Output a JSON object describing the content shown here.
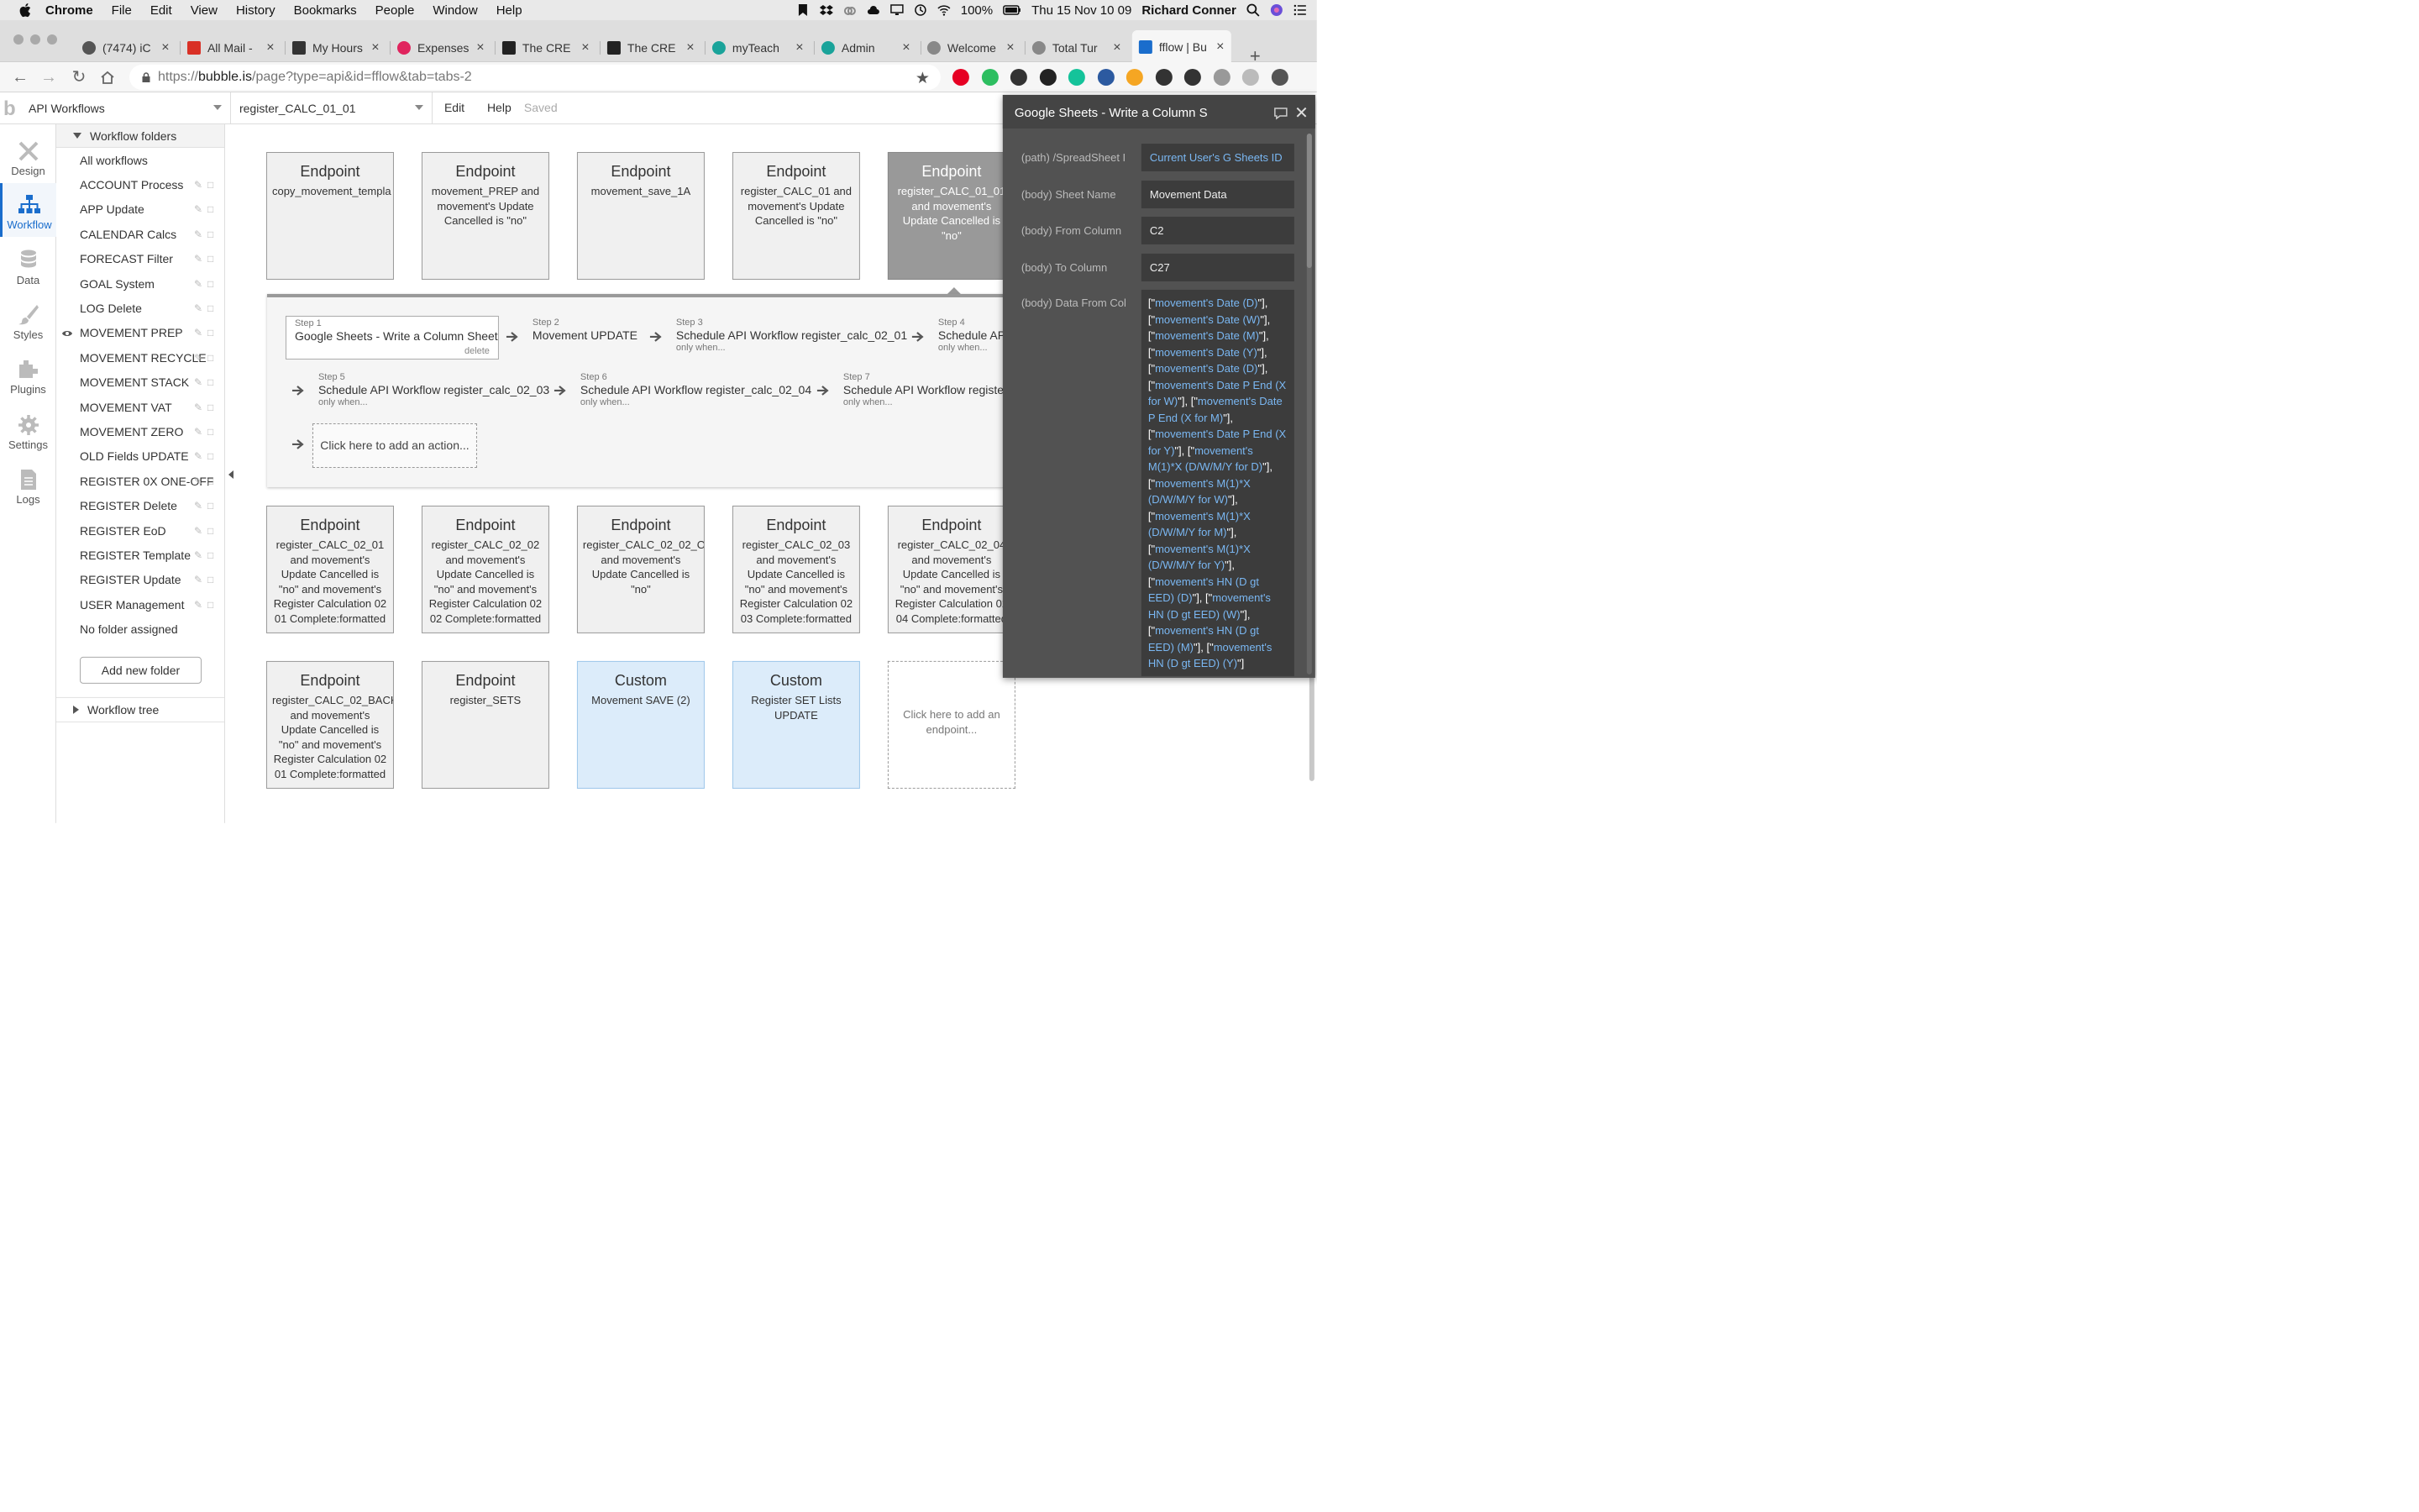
{
  "macbar": {
    "app_name": "Chrome",
    "menus": [
      "File",
      "Edit",
      "View",
      "History",
      "Bookmarks",
      "People",
      "Window",
      "Help"
    ],
    "battery": "100%",
    "clock": "Thu 15 Nov  10 09",
    "user": "Richard Conner"
  },
  "tabs": [
    {
      "title": "(7474) iC",
      "icon": "record-icon",
      "color": "#555555"
    },
    {
      "title": "All Mail -",
      "icon": "gmail-icon",
      "color": "#d93025"
    },
    {
      "title": "My Hours",
      "icon": "stopwatch-icon",
      "color": "#333333"
    },
    {
      "title": "Expenses",
      "icon": "target-icon",
      "color": "#e0245e"
    },
    {
      "title": "The CRE",
      "icon": "bracket-icon",
      "color": "#222222"
    },
    {
      "title": "The CRE",
      "icon": "bracket-icon",
      "color": "#222222"
    },
    {
      "title": "myTeach",
      "icon": "t-icon",
      "color": "#1aa39a"
    },
    {
      "title": "Admin",
      "icon": "t-icon",
      "color": "#1aa39a"
    },
    {
      "title": "Welcome",
      "icon": "spiral-icon",
      "color": "#888888"
    },
    {
      "title": "Total Tur",
      "icon": "spiral-icon",
      "color": "#888888"
    },
    {
      "title": "fflow | Bu",
      "icon": "bubble-icon",
      "color": "#1a6dcc"
    }
  ],
  "address": {
    "url_scheme": "https://",
    "url_host": "bubble.is",
    "url_path": "/page?type=api&id=fflow&tab=tabs-2"
  },
  "extensions": [
    {
      "name": "pinterest-icon",
      "color": "#e60023"
    },
    {
      "name": "evernote-icon",
      "color": "#2dbe60"
    },
    {
      "name": "chart-icon",
      "color": "#333333"
    },
    {
      "name": "owl-icon",
      "color": "#222222"
    },
    {
      "name": "grammarly-icon",
      "color": "#15c39a"
    },
    {
      "name": "grid-icon",
      "color": "#2c5aa0"
    },
    {
      "name": "compass-icon",
      "color": "#f5a623"
    },
    {
      "name": "inbox-icon",
      "color": "#333333"
    },
    {
      "name": "globe-icon",
      "color": "#333333"
    },
    {
      "name": "cloud-icon",
      "color": "#999999"
    },
    {
      "name": "profile-icon",
      "color": "#bbbbbb"
    },
    {
      "name": "menu-icon",
      "color": "#555555"
    }
  ],
  "bubble": {
    "page_select": "API Workflows",
    "workflow_select": "register_CALC_01_01",
    "menu_edit": "Edit",
    "menu_help": "Help",
    "status": "Saved"
  },
  "sidebar": [
    {
      "label": "Design",
      "icon": "design-icon"
    },
    {
      "label": "Workflow",
      "icon": "workflow-icon",
      "active": true
    },
    {
      "label": "Data",
      "icon": "database-icon"
    },
    {
      "label": "Styles",
      "icon": "brush-icon"
    },
    {
      "label": "Plugins",
      "icon": "plugins-icon"
    },
    {
      "label": "Settings",
      "icon": "gear-icon"
    },
    {
      "label": "Logs",
      "icon": "document-icon"
    }
  ],
  "folders": {
    "header": "Workflow folders",
    "all": "All workflows",
    "items": [
      "ACCOUNT Process",
      "APP Update",
      "CALENDAR Calcs",
      "FORECAST Filter",
      "GOAL System",
      "LOG Delete",
      "MOVEMENT PREP",
      "MOVEMENT RECYCLE",
      "MOVEMENT STACK",
      "MOVEMENT VAT",
      "MOVEMENT ZERO",
      "OLD Fields UPDATE",
      "REGISTER 0X ONE-OFF",
      "REGISTER Delete",
      "REGISTER EoD",
      "REGISTER Template",
      "REGISTER Update",
      "USER Management"
    ],
    "no_folder": "No folder assigned",
    "add_button": "Add new folder",
    "tree": "Workflow tree"
  },
  "endpoints_row1": [
    {
      "type": "Endpoint",
      "desc": "copy_movement_templa"
    },
    {
      "type": "Endpoint",
      "desc": "movement_PREP and movement's Update Cancelled is \"no\""
    },
    {
      "type": "Endpoint",
      "desc": "movement_save_1A"
    },
    {
      "type": "Endpoint",
      "desc": "register_CALC_01 and movement's Update Cancelled is \"no\""
    },
    {
      "type": "Endpoint",
      "desc": "register_CALC_01_01 and movement's Update Cancelled is \"no\"",
      "selected": true
    }
  ],
  "steps": [
    {
      "num": "Step 1",
      "name": "Google Sheets - Write a Column Sheet",
      "extra": "delete"
    },
    {
      "num": "Step 2",
      "name": "Movement UPDATE",
      "extra": ""
    },
    {
      "num": "Step 3",
      "name": "Schedule API Workflow register_calc_02_01",
      "extra": "only when..."
    },
    {
      "num": "Step 4",
      "name": "Schedule API",
      "extra": "only when..."
    },
    {
      "num": "Step 5",
      "name": "Schedule API Workflow register_calc_02_03",
      "extra": "only when..."
    },
    {
      "num": "Step 6",
      "name": "Schedule API Workflow register_calc_02_04",
      "extra": "only when..."
    },
    {
      "num": "Step 7",
      "name": "Schedule API Workflow register",
      "extra": "only when..."
    }
  ],
  "add_action": "Click here to add an action...",
  "endpoints_row2": [
    {
      "type": "Endpoint",
      "desc": "register_CALC_02_01 and movement's Update Cancelled is \"no\" and movement's Register Calculation 02 01 Complete:formatted"
    },
    {
      "type": "Endpoint",
      "desc": "register_CALC_02_02 and movement's Update Cancelled is \"no\" and movement's Register Calculation 02 02 Complete:formatted"
    },
    {
      "type": "Endpoint",
      "desc": "register_CALC_02_02_OL and movement's Update Cancelled is \"no\""
    },
    {
      "type": "Endpoint",
      "desc": "register_CALC_02_03 and movement's Update Cancelled is \"no\" and movement's Register Calculation 02 03 Complete:formatted"
    },
    {
      "type": "Endpoint",
      "desc": "register_CALC_02_04 and movement's Update Cancelled is \"no\" and movement's Register Calculation 02 04 Complete:formatted"
    }
  ],
  "endpoints_row3": [
    {
      "type": "Endpoint",
      "desc": "register_CALC_02_BACK and movement's Update Cancelled is \"no\" and movement's Register Calculation 02 01 Complete:formatted"
    },
    {
      "type": "Endpoint",
      "desc": "register_SETS"
    },
    {
      "type": "Custom",
      "desc": "Movement SAVE (2)",
      "custom": true
    },
    {
      "type": "Custom",
      "desc": "Register SET Lists UPDATE",
      "custom": true
    },
    {
      "type": "",
      "desc": "Click here to add an endpoint...",
      "placeholder": true
    }
  ],
  "panel": {
    "title": "Google Sheets - Write a Column S",
    "fields": [
      {
        "label": "(path) /SpreadSheet I",
        "value": "Current User's G Sheets ID",
        "dynamic": true
      },
      {
        "label": "(body) Sheet Name",
        "value": "Movement Data"
      },
      {
        "label": "(body) From Column",
        "value": "C2"
      },
      {
        "label": "(body) To Column",
        "value": "C27"
      }
    ],
    "data_label": "(body) Data From Col",
    "data_items": [
      "movement's Date (D)",
      "movement's Date (W)",
      "movement's Date (M)",
      "movement's Date (Y)",
      "movement's Date (D)",
      "movement's Date P End (X for W)",
      "movement's Date P End (X for M)",
      "movement's Date P End (X for Y)",
      "movement's M(1)*X (D/W/M/Y for D)",
      "movement's M(1)*X (D/W/M/Y for W)",
      "movement's M(1)*X (D/W/M/Y for M)",
      "movement's M(1)*X (D/W/M/Y for Y)",
      "movement's HN (D gt EED) (D)",
      "movement's HN (D gt EED) (W)",
      "movement's HN (D gt EED) (M)",
      "movement's HN (D gt EED) (Y)"
    ]
  }
}
